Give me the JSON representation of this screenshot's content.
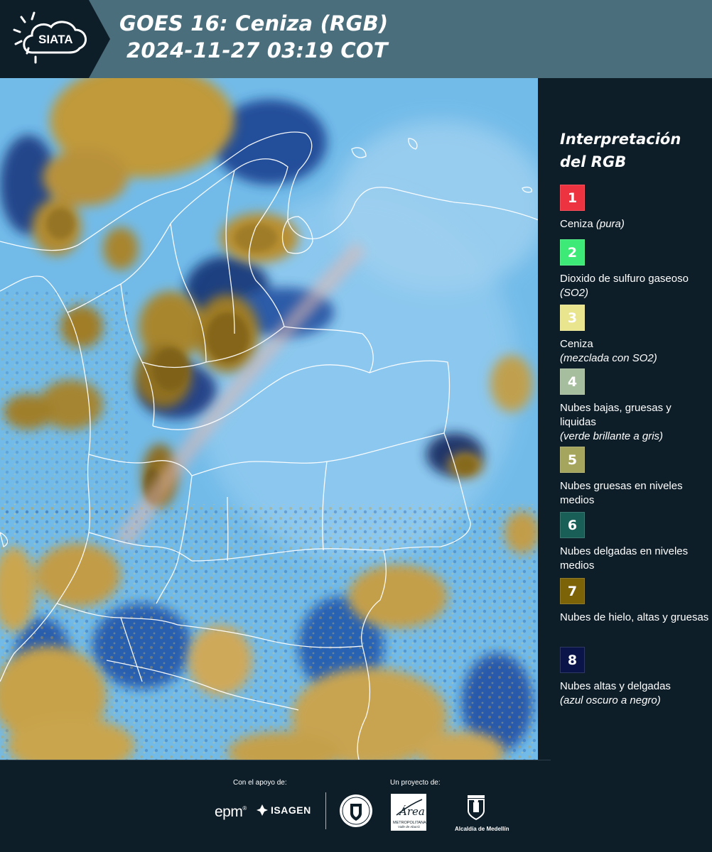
{
  "header": {
    "logo_text": "SIATA",
    "title_line1": "GOES 16: Ceniza (RGB)",
    "title_line2": "2024-11-27 03:19 COT"
  },
  "legend": {
    "title_line1": "Interpretación",
    "title_line2": "del RGB",
    "items": [
      {
        "number": "1",
        "color": "#ee3340",
        "text": "Ceniza ",
        "note": "(pura)"
      },
      {
        "number": "2",
        "color": "#3dea78",
        "text": "Dioxido de sulfuro gaseoso ",
        "note": "(SO2)"
      },
      {
        "number": "3",
        "color": "#e9e48e",
        "text": "Ceniza",
        "note": "(mezclada con SO2)"
      },
      {
        "number": "4",
        "color": "#a6bd9e",
        "text": "Nubes bajas, gruesas y liquidas",
        "note": "(verde brillante a gris)"
      },
      {
        "number": "5",
        "color": "#a5a55e",
        "text": "Nubes gruesas en niveles medios",
        "note": ""
      },
      {
        "number": "6",
        "color": "#1a5e58",
        "text": "Nubes delgadas en niveles medios",
        "note": ""
      },
      {
        "number": "7",
        "color": "#7d6308",
        "text": "Nubes de hielo, altas y gruesas",
        "note": ""
      },
      {
        "number": "8",
        "color": "#0b1448",
        "text": "Nubes altas y delgadas",
        "note": "(azul oscuro a negro)"
      }
    ]
  },
  "footer": {
    "support_label": "Con el apoyo de:",
    "project_label": "Un proyecto de:",
    "epm": "epm",
    "epm_mark": "®",
    "isagen": "ISAGEN",
    "area_text": "Área",
    "area_sub": "METROPOLITANA",
    "area_sub2": "Valle de Aburrá",
    "alcaldia": "Alcaldía de Medellín"
  }
}
